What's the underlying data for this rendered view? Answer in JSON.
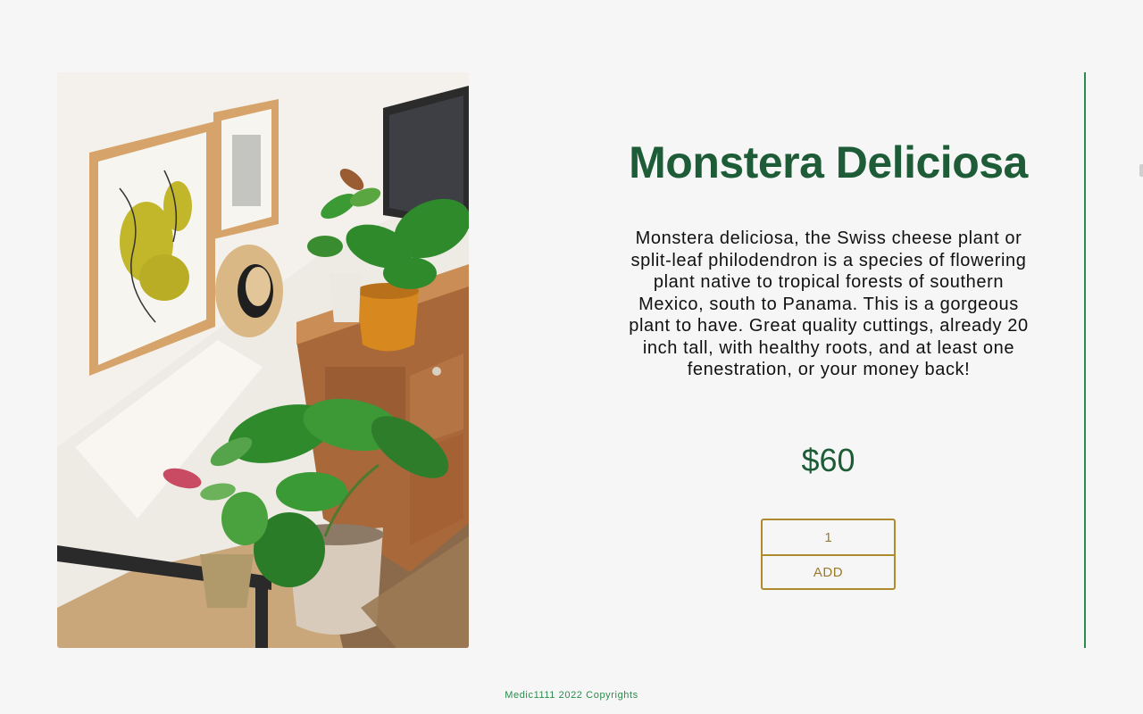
{
  "product": {
    "name": "Monstera Deliciosa",
    "description": "Monstera deliciosa, the Swiss cheese plant or split-leaf philodendron is a species of flowering plant native to tropical forests of southern Mexico, south to Panama. This is a gorgeous plant to have. Great quality cuttings, already 20 inch tall, with healthy roots, and at least one fenestration, or your money back!",
    "price": "$60",
    "image_subject": "monstera plants in pots beside a wooden cabinet with framed art and a hat on the wall"
  },
  "cart": {
    "quantity": "1",
    "add_label": "ADD"
  },
  "footer": {
    "text": "Medic1111 2022 Copyrights"
  },
  "colors": {
    "background": "#f6f6f6",
    "title_green": "#1d5c37",
    "accent_green": "#2c8a4e",
    "gold_border": "#b08b2e"
  }
}
